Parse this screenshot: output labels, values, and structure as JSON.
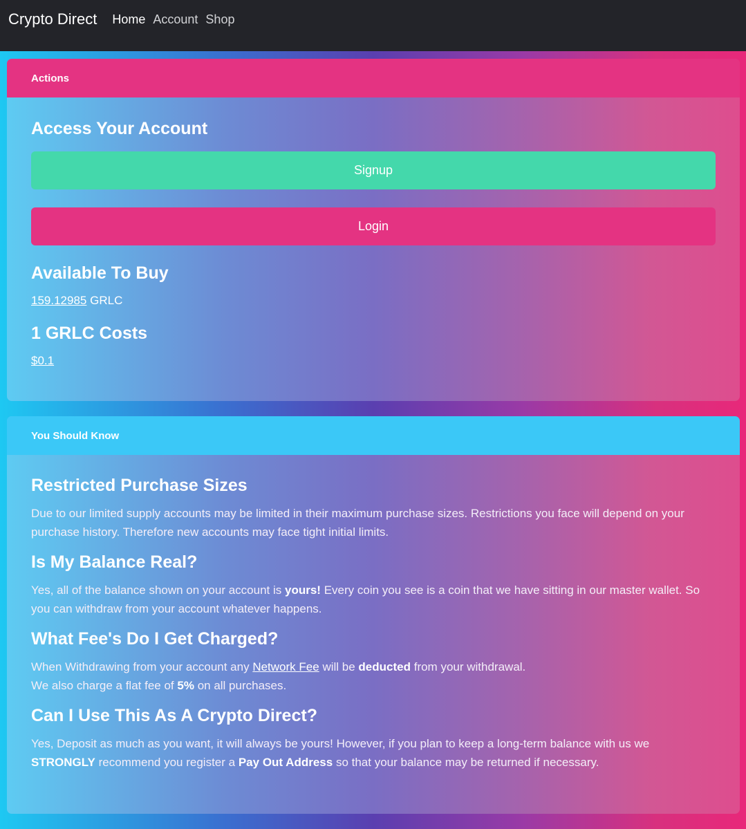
{
  "nav": {
    "brand": "Crypto Direct",
    "links": [
      "Home",
      "Account",
      "Shop"
    ]
  },
  "actions_card": {
    "header": "Actions",
    "access_title": "Access Your Account",
    "signup_label": "Signup",
    "login_label": "Login",
    "available_title": "Available To Buy",
    "available_amount": "159.12985",
    "available_unit": "GRLC",
    "cost_title": "1 GRLC Costs",
    "cost_value": "$0.1"
  },
  "info_card": {
    "header": "You Should Know",
    "sections": [
      {
        "title": "Restricted Purchase Sizes",
        "text": "Due to our limited supply accounts may be limited in their maximum purchase sizes. Restrictions you face will depend on your purchase history. Therefore new accounts may face tight initial limits."
      },
      {
        "title": "Is My Balance Real?",
        "text_a": "Yes, all of the balance shown on your account is",
        "bold_a": "yours!",
        "text_b": "Every coin you see is a coin that we have sitting in our master wallet. So you can withdraw from your account whatever happens."
      },
      {
        "title": "What Fee's Do I Get Charged?",
        "text_a": "When Withdrawing from your account any",
        "link": "Network Fee",
        "text_b": "will be",
        "bold_a": "deducted",
        "text_c": "from your withdrawal.",
        "text_d": "We also charge a flat fee of",
        "bold_b": "5%",
        "text_e": "on all purchases."
      },
      {
        "title": "Can I Use This As A Crypto Direct?",
        "text_a": "Yes, Deposit as much as you want, it will always be yours! However, if you plan to keep a long-term balance with us we",
        "bold_a": "STRONGLY",
        "text_b": "recommend you register a",
        "bold_b": "Pay Out Address",
        "text_c": "so that your balance may be returned if necessary."
      }
    ]
  },
  "colors": {
    "navbar": "#232429",
    "signup": "#44d8ab",
    "pink": "#e43382",
    "cyan": "#3bc8f7"
  }
}
